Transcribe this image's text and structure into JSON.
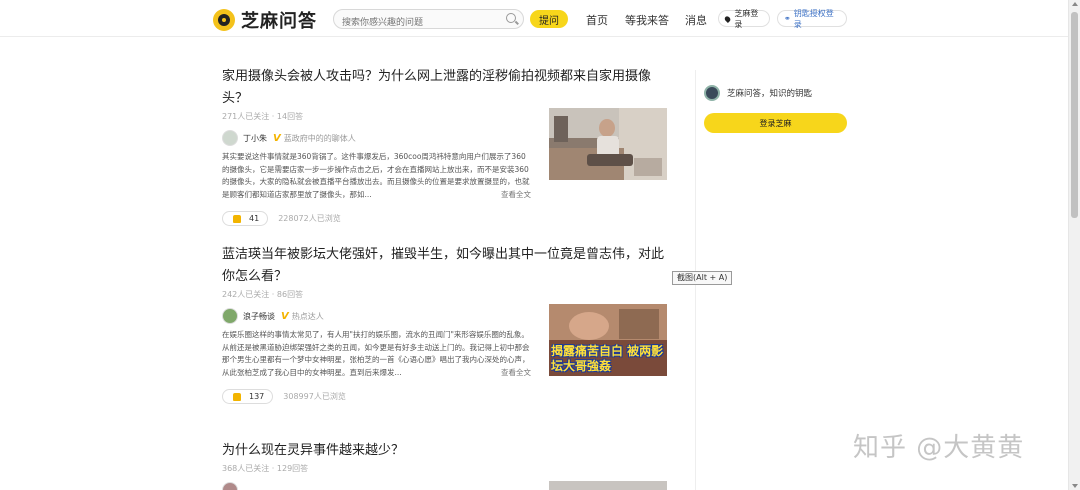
{
  "app": {
    "logo_text": "芝麻问答",
    "colors": {
      "accent": "#f7d61b",
      "link": "#3a6fc4"
    }
  },
  "header": {
    "search_placeholder": "搜索你感兴趣的问题",
    "ask_label": "提问",
    "nav": {
      "home": "首页",
      "wait_answer": "等我来答",
      "messages": "消息"
    },
    "zhima_login": "芝麻登录",
    "auth_login": "钥匙授权登录"
  },
  "feed": [
    {
      "title": "家用摄像头会被人攻击吗？为什么网上泄露的淫秽偷拍视频都来自家用摄像头？",
      "meta": "271人已关注 · 14回答",
      "author": "丁小朱",
      "author_desc": "蓝政府中的的聊体人",
      "excerpt": "其实要说这件事情就是360背锅了。这件事爆发后，360coo周鸿祎特意向用户们展示了360的摄像头，它是需要店家一步一步操作点击之后，才会在直播网站上放出来，而不是安装360的摄像头，大家的隐私就会被直播平台播放出去。而且摄像头的位置是要求放置摄显的，也就是顾客们都知道店家那里放了摄像头，那如...",
      "read_more": "查看全文",
      "likes": "41",
      "views": "228072人已浏览"
    },
    {
      "title": "蓝洁瑛当年被影坛大佬强奸，摧毁半生，如今曝出其中一位竟是曾志伟，对此你怎么看？",
      "meta": "242人已关注 · 86回答",
      "author": "浪子畅谈",
      "author_desc": "热点达人",
      "excerpt": "在娱乐圈这样的事情太常见了，有人用\"扶打的娱乐圈，流水的丑闻门\"来形容娱乐圈的乱象。从前还是被黑道胁迫绑架强奸之类的丑闻，如今更是有好多主动送上门的。我记得上初中那会那个男生心里都有一个梦中女神明星，张柏芝的一首《心语心愿》唱出了我内心深处的心声，从此张柏芝成了我心目中的女神明星。直到后来爆发...",
      "read_more": "查看全文",
      "likes": "137",
      "views": "308997人已浏览",
      "image_caption": "揭露痛苦自白 被两影坛大哥強姦"
    },
    {
      "title": "为什么现在灵异事件越来越少？",
      "meta": "368人已关注 · 129回答"
    }
  ],
  "sidebar": {
    "slogan": "芝麻问答，知识的钥匙",
    "login_label": "登录芝麻"
  },
  "tooltip": "截图(Alt + A)",
  "watermark": "知乎 @大黄黄"
}
